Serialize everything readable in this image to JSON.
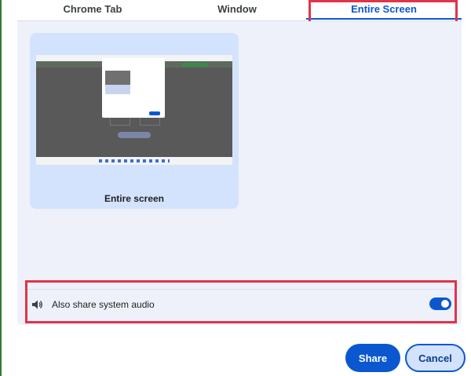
{
  "tabs": [
    {
      "label": "Chrome Tab",
      "selected": false
    },
    {
      "label": "Window",
      "selected": false
    },
    {
      "label": "Entire Screen",
      "selected": true
    }
  ],
  "screen_option": {
    "label": "Entire screen",
    "selected": true
  },
  "audio": {
    "icon": "speaker-icon",
    "label": "Also share system audio",
    "enabled": true
  },
  "buttons": {
    "share": "Share",
    "cancel": "Cancel"
  },
  "colors": {
    "accent": "#0b57d0",
    "highlight": "#e0344a",
    "panel": "#eef1f9",
    "selected_card": "#d3e3fd"
  }
}
